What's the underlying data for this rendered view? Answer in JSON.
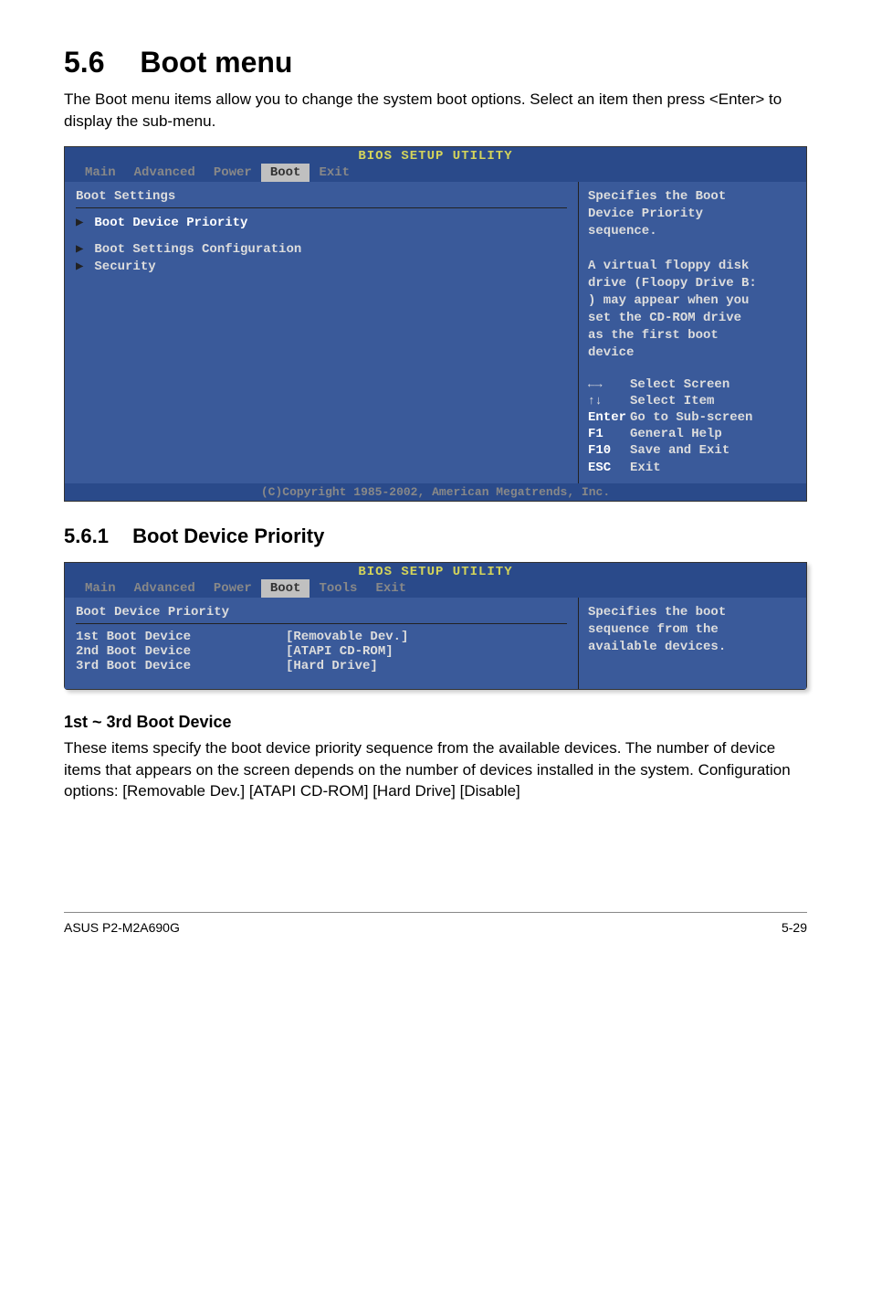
{
  "section": {
    "num": "5.6",
    "title": "Boot menu",
    "intro": "The Boot menu items allow you to change the system boot options. Select an item then press <Enter> to display the sub-menu."
  },
  "bios1": {
    "title": "BIOS SETUP UTILITY",
    "tabs": [
      "Main",
      "Advanced",
      "Power",
      "Boot",
      "Exit"
    ],
    "heading": "Boot Settings",
    "items": [
      {
        "label": "Boot Device Priority",
        "highlighted": true
      },
      {
        "label": "Boot Settings Configuration",
        "highlighted": false
      },
      {
        "label": "Security",
        "highlighted": false
      }
    ],
    "help": {
      "line1": "Specifies the Boot",
      "line2": "Device Priority",
      "line3": "sequence.",
      "blank": "",
      "line4": "A virtual floppy disk",
      "line5": "drive (Floopy Drive B:",
      "line6": ") may appear when you",
      "line7": "set the CD-ROM drive",
      "line8": "as the first boot",
      "line9": "device"
    },
    "keys": [
      {
        "key": "←→",
        "desc": "Select Screen"
      },
      {
        "key": "↑↓",
        "desc": "Select Item"
      },
      {
        "key": "Enter",
        "desc": "Go to Sub-screen"
      },
      {
        "key": "F1",
        "desc": "General Help"
      },
      {
        "key": "F10",
        "desc": "Save and Exit"
      },
      {
        "key": "ESC",
        "desc": "Exit"
      }
    ],
    "copyright": "(C)Copyright 1985-2002, American Megatrends, Inc."
  },
  "subsection": {
    "num": "5.6.1",
    "title": "Boot Device Priority"
  },
  "bios2": {
    "title": "BIOS SETUP UTILITY",
    "tabs": [
      "Main",
      "Advanced",
      "Power",
      "Boot",
      "Tools",
      "Exit"
    ],
    "heading": "Boot Device Priority",
    "items": [
      {
        "label": "1st Boot Device",
        "value": "[Removable Dev.]"
      },
      {
        "label": "2nd Boot Device",
        "value": "[ATAPI CD-ROM]"
      },
      {
        "label": "3rd Boot Device",
        "value": "[Hard Drive]"
      }
    ],
    "help": {
      "line1": "Specifies the boot",
      "line2": "sequence from the",
      "line3": "available devices."
    }
  },
  "device_section": {
    "heading": "1st ~ 3rd Boot Device",
    "text": "These items specify the boot device priority sequence from the available devices. The number of device items that appears on the screen depends on the number of devices installed in the system. Configuration options: [Removable Dev.] [ATAPI CD-ROM] [Hard Drive] [Disable]"
  },
  "footer": {
    "left": "ASUS P2-M2A690G",
    "right": "5-29"
  }
}
